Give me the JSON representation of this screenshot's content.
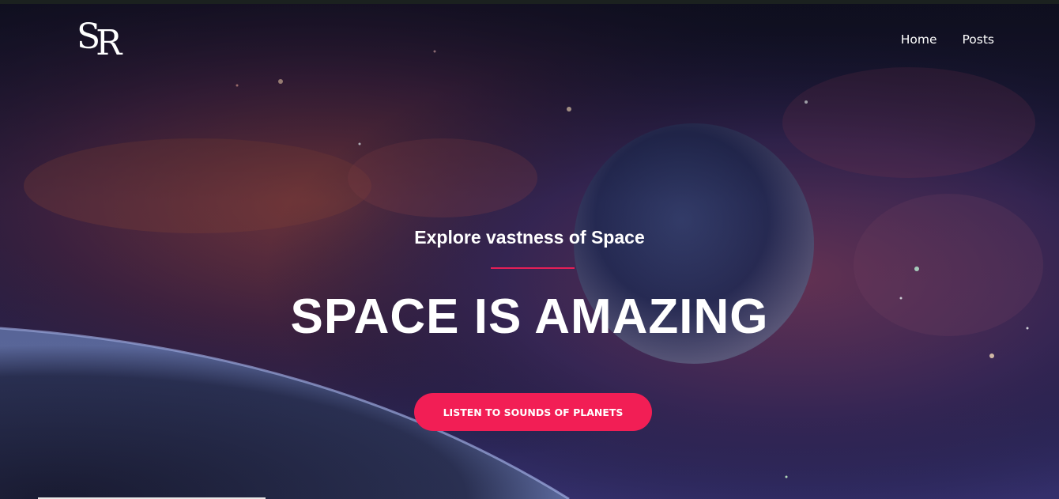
{
  "header": {
    "logo_text_1": "S",
    "logo_text_2": "R",
    "nav": [
      {
        "label": "Home"
      },
      {
        "label": "Posts"
      }
    ]
  },
  "hero": {
    "subtitle": "Explore vastness of Space",
    "title": "SPACE IS AMAZING",
    "cta_label": "LISTEN TO SOUNDS OF PLANETS"
  },
  "colors": {
    "accent": "#f21e55",
    "divider": "#e51f57",
    "text": "#ffffff",
    "background": "#1a1a3a"
  }
}
